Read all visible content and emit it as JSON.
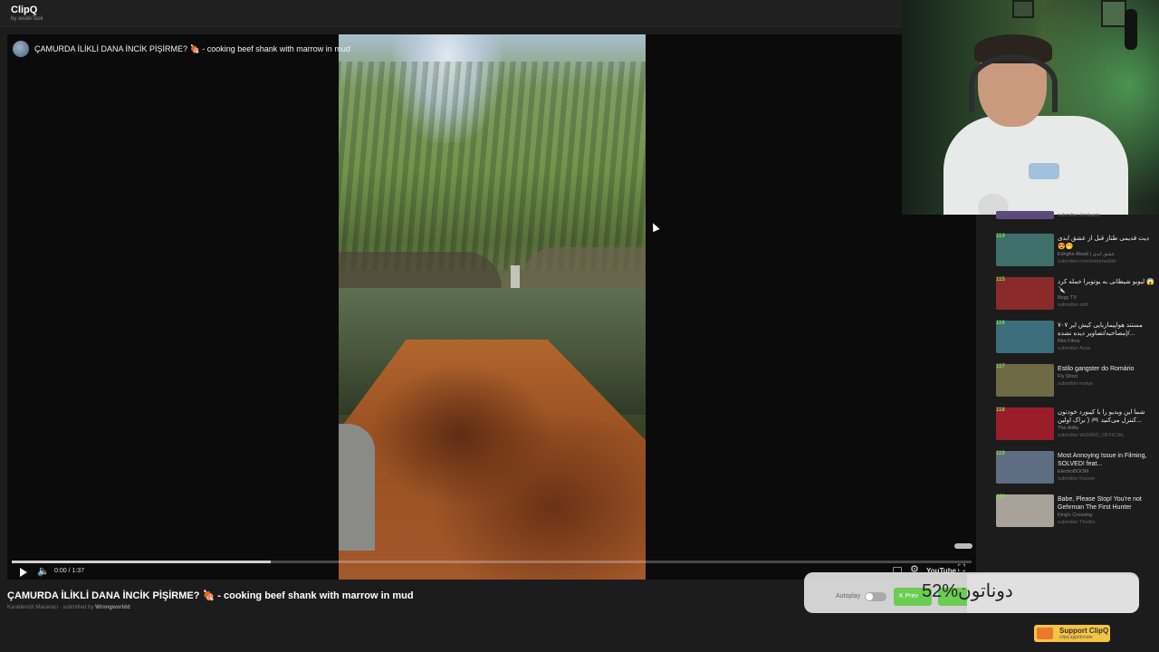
{
  "app": {
    "name": "ClipQ",
    "tagline": "by awalkTask"
  },
  "video": {
    "title": "ÇAMURDA İLİKLİ DANA İNCİK PİŞİRME? 🍖 - cooking beef shank with marrow in mud",
    "channel": "Karadenizli Maceracı",
    "submitted_prefix": "· submitted by",
    "submitter": "Wrongworldd",
    "time": "0:00 / 1:37",
    "progress_fraction": 0.27,
    "platform_logo": "YouTube"
  },
  "queue": [
    {
      "rank": "114",
      "title": "دیت قدیمی طناز قبل از عشق ابدی 😍🤭",
      "channel": "Eshghe Abadi | عشق ابدی",
      "submitter": "submitter mmohammaddd",
      "thumb_color": "#3f6f6a"
    },
    {
      "rank": "115",
      "title": "لیوبو شیطانی به یوتوبرا حمله کرد 😱🔪",
      "channel": "Bogy TV",
      "submitter": "submitter add",
      "thumb_color": "#8a2a2a"
    },
    {
      "rank": "116",
      "title": "مستند هواپیماربایی کیش ایر ۷۰۷ (مصاحبه/تصاویر دیده نشده/...",
      "channel": "Rim Films",
      "submitter": "submitter Azya",
      "thumb_color": "#3b6d7a"
    },
    {
      "rank": "117",
      "title": "Estilo gangster do Romário",
      "channel": "Fly Short",
      "submitter": "submitter moiya",
      "thumb_color": "#6d6a45"
    },
    {
      "rank": "118",
      "title": "شما این ویدیو را با کیبورد خودتون کنترل می‌کنید 🎮 ( براک اولین...",
      "channel": "The AllAz",
      "submitter": "submitter WIZARD_OFFICIAL",
      "thumb_color": "#9c1d2a"
    },
    {
      "rank": "119",
      "title": "Most Annoying Issue in Filming, SOLVED! feat...",
      "channel": "ElectroBOOM",
      "submitter": "submitter Kozem",
      "thumb_color": "#5f6d82"
    },
    {
      "rank": "120",
      "title": "Babe, Please Stop! You're not Gehrman The First Hunter",
      "channel": "King's Crossing",
      "submitter": "submitter TheWz",
      "thumb_color": "#a8a29a"
    }
  ],
  "partial_item": {
    "submitter": "submitter Xmikaels",
    "thumb_color": "#5c4b7a"
  },
  "controls": {
    "autoplay_label": "Autoplay",
    "prev_label": "K Prev",
    "donation_text": "52%دوناتون"
  },
  "support": {
    "label": "Support ClipQ",
    "url": "clipq.app/donate"
  },
  "icons": {
    "play": "play-icon",
    "volume": "volume-icon",
    "settings": "settings-icon",
    "fullscreen": "fullscreen-icon",
    "captions": "captions-icon"
  },
  "colors": {
    "accent_green": "#6ccc53",
    "rank_green": "#7ed957",
    "support_yellow": "#f4c542"
  }
}
